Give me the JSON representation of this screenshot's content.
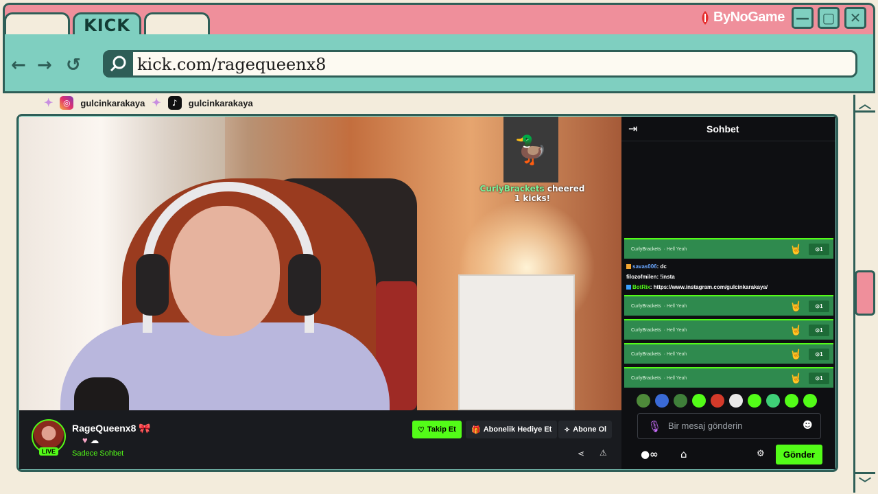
{
  "window": {
    "tabs": [
      "",
      "KICK",
      ""
    ],
    "brand": "ByNoGame",
    "controls": {
      "minimize": "—",
      "maximize": "▢",
      "close": "✕"
    }
  },
  "nav": {
    "back": "←",
    "forward": "→",
    "reload": "↺",
    "url": "kick.com/ragequeenx8",
    "search_icon": "search-icon"
  },
  "socials": [
    {
      "platform": "instagram",
      "handle": "gulcinkarakaya"
    },
    {
      "platform": "tiktok",
      "handle": "gulcinkarakaya"
    }
  ],
  "stream": {
    "overlay_user": "CurlyBrackets",
    "overlay_text": " cheered 1 kicks!"
  },
  "channel": {
    "name": "RageQueenx8",
    "live_label": "LIVE",
    "status": "Sadece Sohbet",
    "follow_label": "Takip Et",
    "gift_label": "Abonelik Hediye Et",
    "subscribe_label": "Abone Ol"
  },
  "chat": {
    "title": "Sohbet",
    "cheers": [
      {
        "user": "CurlyBrackets",
        "text": "· Hell Yeah",
        "amount": "1"
      },
      {
        "user": "CurlyBrackets",
        "text": "· Hell Yeah",
        "amount": "1"
      },
      {
        "user": "CurlyBrackets",
        "text": "· Hell Yeah",
        "amount": "1"
      },
      {
        "user": "CurlyBrackets",
        "text": "· Hell Yeah",
        "amount": "1"
      },
      {
        "user": "CurlyBrackets",
        "text": "· Hell Yeah",
        "amount": "1"
      }
    ],
    "messages": [
      {
        "user": "savas006",
        "text": ": dc",
        "color": "#6aa7ff"
      },
      {
        "user": "filozofmilen",
        "text": ": !insta",
        "color": "#ffffff"
      },
      {
        "user": "BotRix",
        "text": ": https://www.instagram.com/gulcinkarakaya/",
        "color": "#53fc18"
      }
    ],
    "input_placeholder": "Bir mesaj gönderin",
    "send_label": "Gönder"
  },
  "colors": {
    "kick_green": "#53fc18",
    "frame_pink": "#ef8f9b",
    "frame_teal": "#7fcfc0",
    "frame_dark": "#2e5e57"
  }
}
